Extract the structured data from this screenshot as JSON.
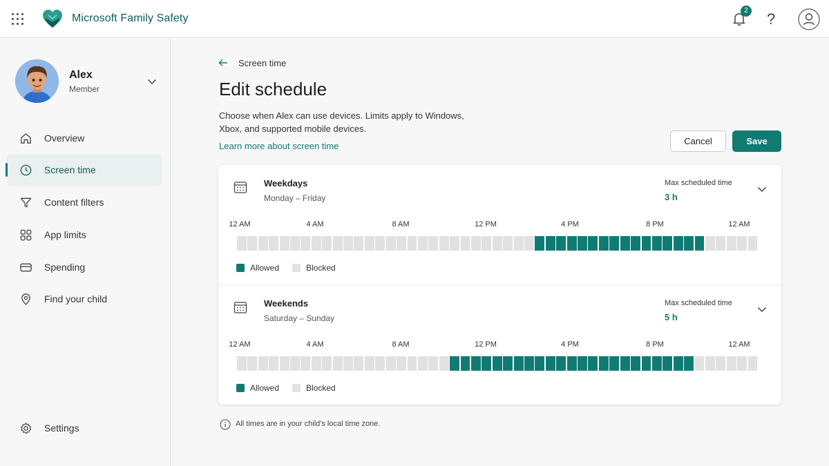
{
  "app": {
    "title": "Microsoft Family Safety",
    "notification_count": "2",
    "help_label": "?"
  },
  "profile": {
    "name": "Alex",
    "role": "Member"
  },
  "sidebar": {
    "items": [
      {
        "label": "Overview",
        "icon": "home-icon",
        "active": false
      },
      {
        "label": "Screen time",
        "icon": "clock-icon",
        "active": true
      },
      {
        "label": "Content filters",
        "icon": "filter-icon",
        "active": false
      },
      {
        "label": "App limits",
        "icon": "apps-grid-icon",
        "active": false
      },
      {
        "label": "Spending",
        "icon": "card-icon",
        "active": false
      },
      {
        "label": "Find your child",
        "icon": "location-pin-icon",
        "active": false
      }
    ],
    "settings_label": "Settings"
  },
  "main": {
    "breadcrumb": "Screen time",
    "title": "Edit schedule",
    "description": "Choose when Alex can use devices. Limits apply to Windows, Xbox, and supported mobile devices.",
    "learn_more": "Learn more about screen time",
    "cancel_label": "Cancel",
    "save_label": "Save",
    "footnote": "All times are in your child's local time zone."
  },
  "schedules": [
    {
      "title": "Weekdays",
      "subtitle": "Monday – Friday",
      "max_label": "Max scheduled time",
      "max_value": "3 h",
      "ticks": [
        "12 AM",
        "4 AM",
        "8 AM",
        "12 PM",
        "4 PM",
        "8 PM",
        "12 AM"
      ],
      "total_slots": 49,
      "allowed_slots": [
        28,
        43
      ],
      "legend_allowed": "Allowed",
      "legend_blocked": "Blocked"
    },
    {
      "title": "Weekends",
      "subtitle": "Saturday – Sunday",
      "max_label": "Max scheduled time",
      "max_value": "5 h",
      "ticks": [
        "12 AM",
        "4 AM",
        "8 AM",
        "12 PM",
        "4 PM",
        "8 PM",
        "12 AM"
      ],
      "total_slots": 49,
      "allowed_slots": [
        20,
        42
      ],
      "legend_allowed": "Allowed",
      "legend_blocked": "Blocked"
    }
  ],
  "colors": {
    "accent": "#0f7b73",
    "blocked": "#e1e1e1",
    "brand_text": "#0f5c58"
  }
}
